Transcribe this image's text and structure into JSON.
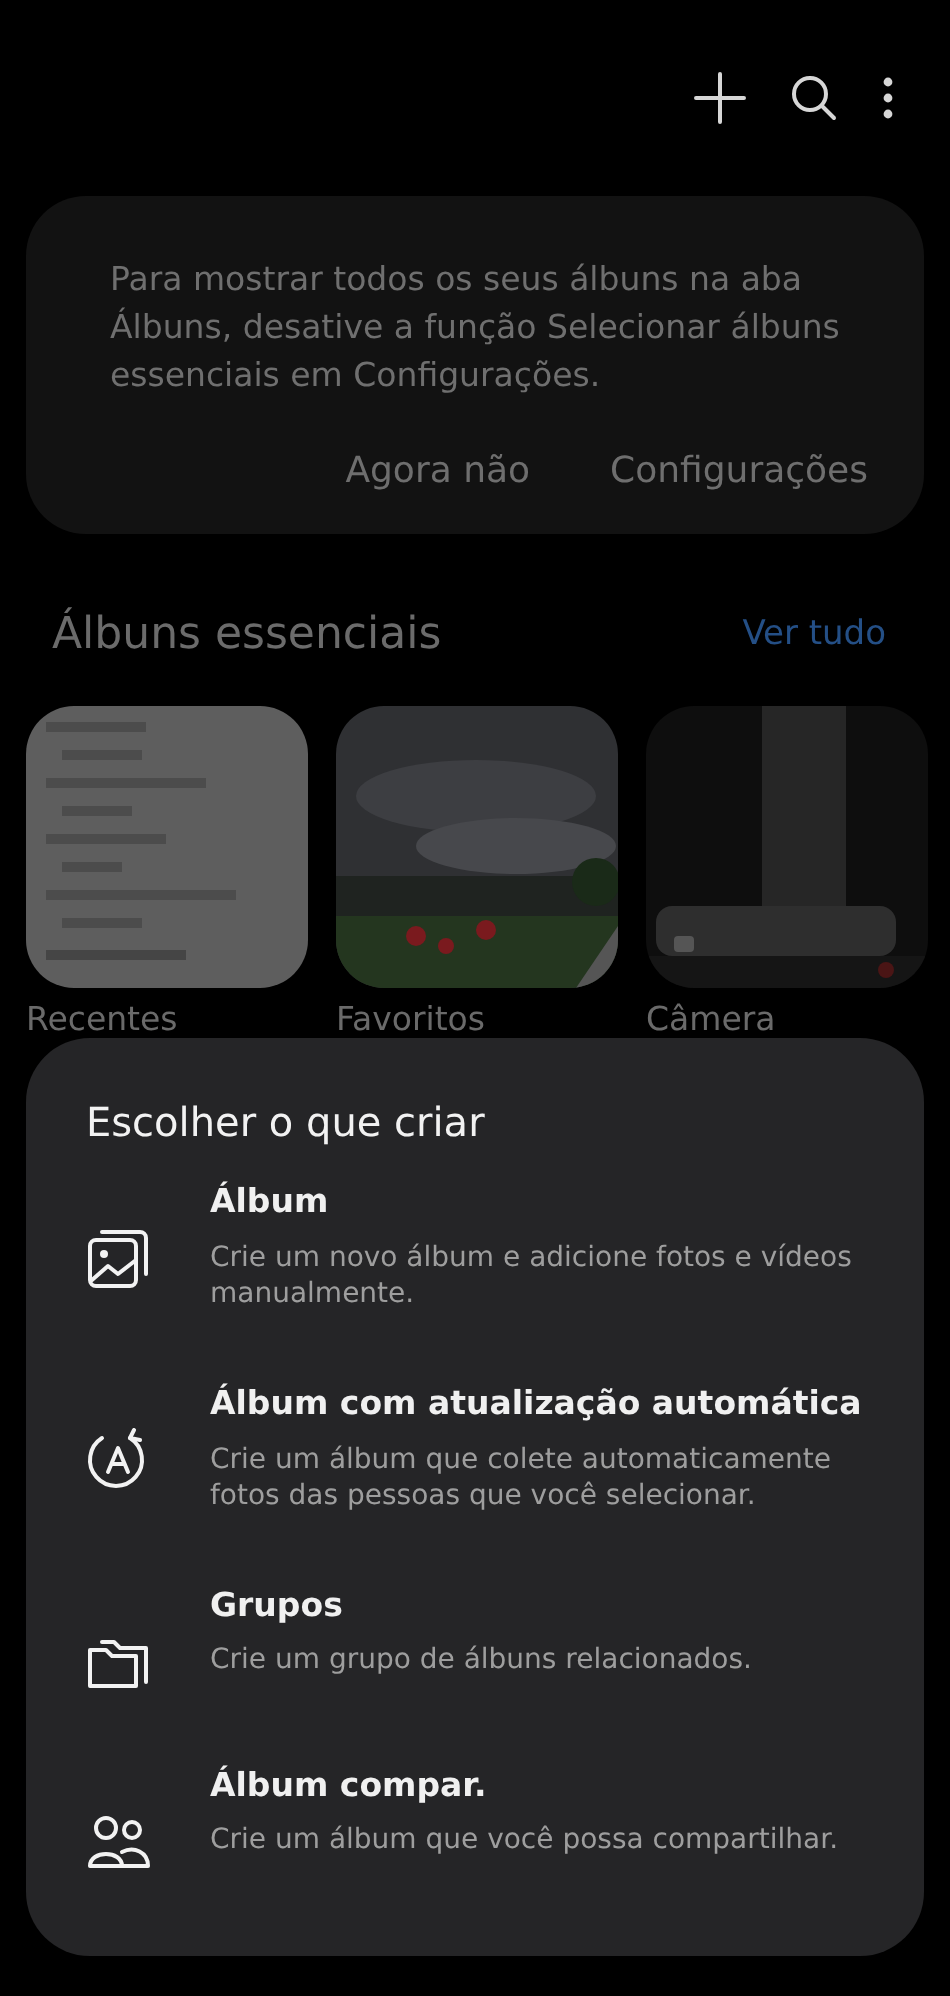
{
  "toolbar": {
    "actions": [
      {
        "kind": "add"
      },
      {
        "kind": "search"
      },
      {
        "kind": "more"
      }
    ]
  },
  "notice": {
    "message": "Para mostrar todos os seus álbuns na aba Álbuns, desative a função Selecionar álbuns essenciais em Configurações.",
    "buttons": [
      "Agora não",
      "Configurações"
    ]
  },
  "essential_albums": {
    "title": "Álbuns essenciais",
    "link": "Ver tudo",
    "albums": [
      {
        "name": "Recentes"
      },
      {
        "name": "Favoritos"
      },
      {
        "name": "Câmera"
      }
    ]
  },
  "create_sheet": {
    "title": "Escolher o que criar",
    "options": [
      {
        "kind": "album",
        "title": "Álbum",
        "description": "Crie um novo álbum e adicione fotos e vídeos manualmente."
      },
      {
        "kind": "auto",
        "title": "Álbum com atualização automática",
        "description": "Crie um álbum que colete automaticamente fotos das pessoas que você selecionar."
      },
      {
        "kind": "group",
        "title": "Grupos",
        "description": "Crie um grupo de álbuns relacionados."
      },
      {
        "kind": "shared",
        "title": "Álbum compar.",
        "description": "Crie um álbum que você possa compartilhar."
      }
    ]
  }
}
